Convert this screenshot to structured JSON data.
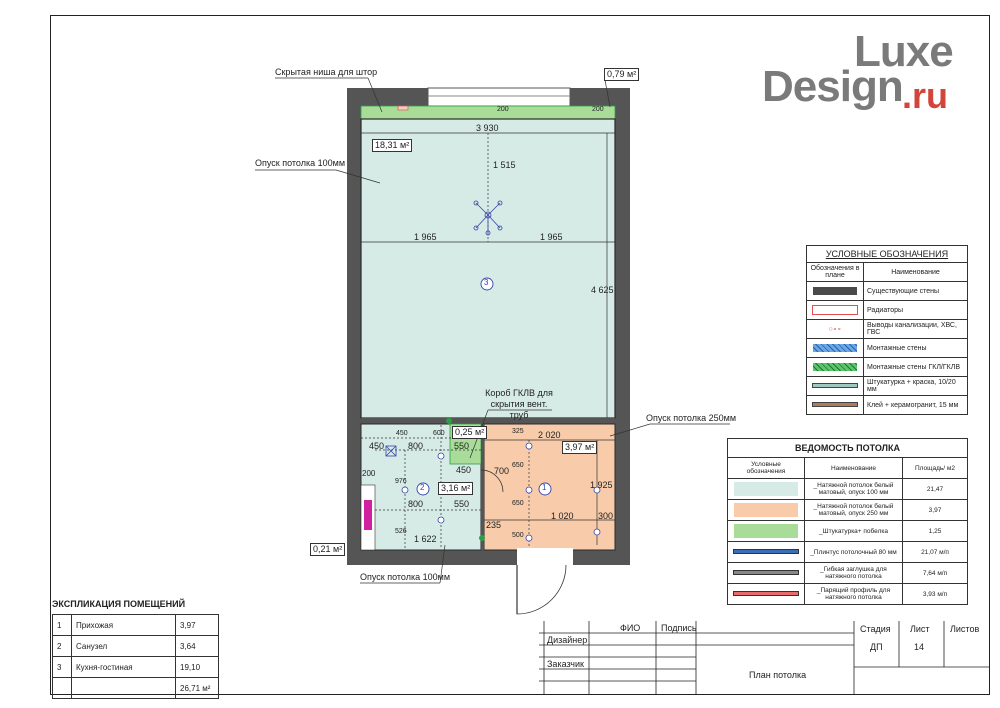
{
  "logo": {
    "part1": "Luxe",
    "part2": "Design",
    "part3": ".ru"
  },
  "plan": {
    "callouts": {
      "curtain": "Скрытая ниша для штор",
      "area_top": "0,79 м²",
      "drop100_top": "Опуск потолка 100мм",
      "gklv_box": "Короб ГКЛВ для скрытия вент. труб",
      "drop250": "Опуск потолка 250мм",
      "area_left": "0,21 м²",
      "drop100_bottom": "Опуск потолка 100мм"
    },
    "areas": {
      "main": "18,31 м²",
      "corridor": "3,97 м²",
      "bath": "3,16 м²",
      "box": "0,25 м²"
    },
    "rooms": {
      "r1": "1",
      "r2": "2",
      "r3": "3"
    },
    "dims": {
      "d3930": "3 930",
      "d200a": "200",
      "d200b": "200",
      "d1515": "1 515",
      "d1965a": "1 965",
      "d1965b": "1 965",
      "d4625": "4 625",
      "d2020": "2 020",
      "d325": "325",
      "d1925": "1 925",
      "d700": "700",
      "d650a": "650",
      "d650b": "650",
      "d1020": "1 020",
      "d300": "300",
      "d235": "235",
      "d500": "500",
      "d450a": "450",
      "d450b": "450",
      "d800a": "800",
      "d800b": "800",
      "d600": "600",
      "d550a": "550",
      "d550b": "550",
      "d976": "976",
      "d200c": "200",
      "d526": "526",
      "d1622": "1 622",
      "d450c": "450"
    }
  },
  "legend": {
    "title": "УСЛОВНЫЕ ОБОЗНАЧЕНИЯ",
    "col1": "Обозначения в плане",
    "col2": "Наименование",
    "rows": [
      {
        "label": "Существующие стены",
        "color": "#4a4a4a"
      },
      {
        "label": "Радиаторы",
        "color": "#f4c9c9"
      },
      {
        "label": "Выводы канализации, ХВС, ГВС",
        "color": "#e05050"
      },
      {
        "label": "Монтажные стены",
        "color": "#6aa7e6"
      },
      {
        "label": "Монтажные стены ГКЛ/ГКЛВ",
        "color": "#2e9e47"
      },
      {
        "label": "Штукатурка + краска, 10/20 мм",
        "color": "#9ec9c0"
      },
      {
        "label": "Клей + керамогранит, 15 мм",
        "color": "#b07a5a"
      }
    ]
  },
  "ceiling_sheet": {
    "title": "ВЕДОМОСТЬ ПОТОЛКА",
    "headers": [
      "Условные обозначения",
      "Наименование",
      "Площадь/ м2"
    ],
    "rows": [
      {
        "name": "_Натяжной потолок белый матовый, опуск 100 мм",
        "value": "21,47",
        "color": "#d6ebe6"
      },
      {
        "name": "_Натяжной потолок белый матовый, опуск 250 мм",
        "value": "3,97",
        "color": "#f8ccaa"
      },
      {
        "name": "_Штукатурка+ побелка",
        "value": "1,25",
        "color": "#a8dc98"
      },
      {
        "name": "_Плинтус потолочный 80 мм",
        "value": "21,07 м/п",
        "color": "#3d6fb8"
      },
      {
        "name": "_Гибкая заглушка для натяжного потолка",
        "value": "7,64 м/п",
        "color": "#888888"
      },
      {
        "name": "_Парящий профиль для натяжного потолка",
        "value": "3,93 м/п",
        "color": "#e86a6a"
      }
    ]
  },
  "explication": {
    "title": "ЭКСПЛИКАЦИЯ ПОМЕЩЕНИЙ",
    "rows": [
      {
        "num": "1",
        "name": "Прихожая",
        "area": "3,97"
      },
      {
        "num": "2",
        "name": "Санузел",
        "area": "3,64"
      },
      {
        "num": "3",
        "name": "Кухня-гостиная",
        "area": "19,10"
      }
    ],
    "total": "26,71 м²"
  },
  "stamp": {
    "fio": "ФИО",
    "sign": "Подпись",
    "designer": "Дизайнер",
    "customer": "Заказчик",
    "stage_h": "Стадия",
    "sheet_h": "Лист",
    "sheets_h": "Листов",
    "stage": "ДП",
    "sheet": "14",
    "title": "План потолка"
  }
}
